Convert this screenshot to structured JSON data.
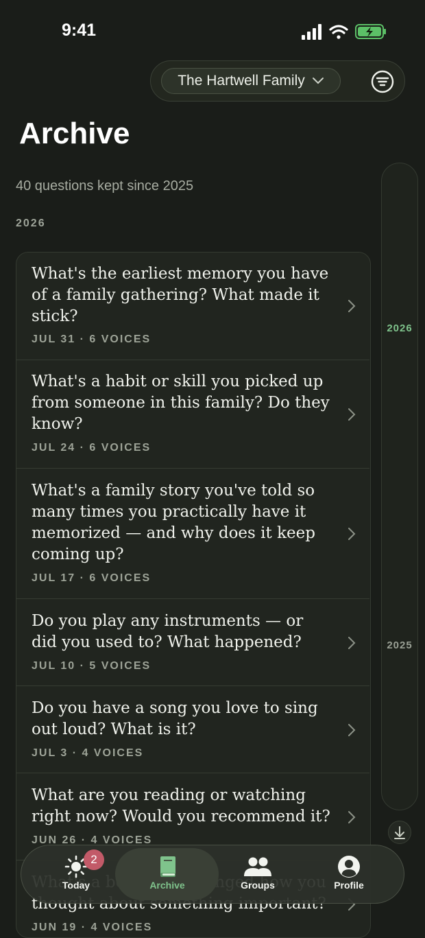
{
  "status_bar": {
    "time": "9:41"
  },
  "header": {
    "group_name": "The Hartwell Family"
  },
  "page": {
    "title": "Archive",
    "subtitle": "40 questions kept since 2025",
    "year_heading": "2026"
  },
  "timeline": {
    "years": [
      "2026",
      "2025"
    ],
    "active_year": "2026"
  },
  "questions": [
    {
      "text": "What's the earliest memory you have of a family gathering? What made it stick?",
      "meta": "JUL 31 · 6 VOICES"
    },
    {
      "text": "What's a habit or skill you picked up from someone in this family? Do they know?",
      "meta": "JUL 24 · 6 VOICES"
    },
    {
      "text": "What's a family story you've told so many times you practically have it memorized — and why does it keep coming up?",
      "meta": "JUL 17 · 6 VOICES"
    },
    {
      "text": "Do you play any instruments — or did you used to? What happened?",
      "meta": "JUL 10 · 5 VOICES"
    },
    {
      "text": "Do you have a song you love to sing out loud? What is it?",
      "meta": "JUL 3 · 4 VOICES"
    },
    {
      "text": "What are you reading or watching right now? Would you recommend it?",
      "meta": "JUN 26 · 4 VOICES"
    },
    {
      "text": "What's a book that changed how you thought about something important?",
      "meta": "JUN 19 · 4 VOICES"
    }
  ],
  "tabs": [
    {
      "label": "Today",
      "icon": "sun-icon",
      "badge": "2"
    },
    {
      "label": "Archive",
      "icon": "book-icon"
    },
    {
      "label": "Groups",
      "icon": "people-icon"
    },
    {
      "label": "Profile",
      "icon": "person-circle-icon"
    }
  ],
  "colors": {
    "accent": "#7fc38c",
    "badge": "#c25a68",
    "background": "#1a1d19"
  }
}
